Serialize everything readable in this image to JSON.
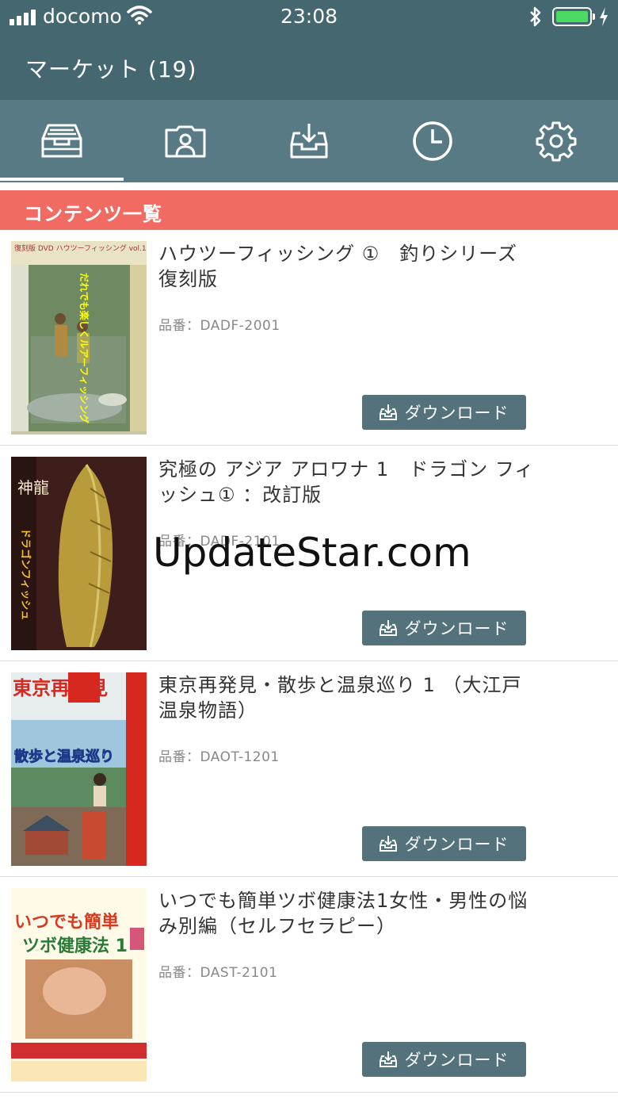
{
  "status": {
    "carrier": "docomo",
    "time": "23:08"
  },
  "nav": {
    "title": "マーケット (19)"
  },
  "tabs": [
    {
      "icon": "market-tray-icon"
    },
    {
      "icon": "profile-card-icon"
    },
    {
      "icon": "download-tray-icon"
    },
    {
      "icon": "clock-icon"
    },
    {
      "icon": "gear-icon"
    }
  ],
  "section": {
    "title": "コンテンツ一覧"
  },
  "items": [
    {
      "title": "ハウツーフィッシング ①　釣りシリーズ 復刻版",
      "code": "品番：DADF-2001",
      "button": "ダウンロード",
      "cover": {
        "top": "復刻版 DVD ハウツーフィッシング vol.1",
        "mid": "だれでも楽しくルアーフィッシング"
      }
    },
    {
      "title": "究極の アジア アロワナ 1　ドラゴン フィッシュ① ：改訂版",
      "code": "品番：DADF-2101",
      "button": "ダウンロード",
      "cover": {
        "top": "神龍",
        "mid": "ドラゴンフィッシュ"
      }
    },
    {
      "title": "東京再発見・散歩と温泉巡り 1 （大江戸温泉物語）",
      "code": "品番：DAOT-1201",
      "button": "ダウンロード",
      "cover": {
        "top": "東京再発見",
        "mid": "散歩と温泉巡り"
      }
    },
    {
      "title": "いつでも簡単ツボ健康法1女性・男性の悩み別編（セルフセラピー）",
      "code": "品番：DAST-2101",
      "button": "ダウンロード",
      "cover": {
        "top": "いつでも簡単",
        "mid": "ツボ健康法 1"
      }
    }
  ],
  "watermark": "UpdateStar.com"
}
